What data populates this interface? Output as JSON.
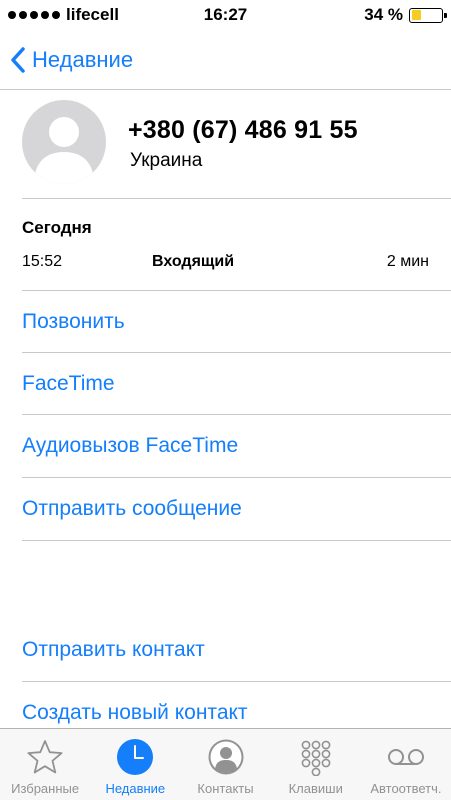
{
  "status_bar": {
    "carrier": "lifecell",
    "time": "16:27",
    "battery_percent": "34 %",
    "battery_level": 0.34
  },
  "nav": {
    "back_label": "Недавние"
  },
  "contact": {
    "phone_number": "+380 (67) 486 91 55",
    "country": "Украина"
  },
  "call_log": {
    "date": "Сегодня",
    "time": "15:52",
    "type": "Входящий",
    "duration": "2 мин"
  },
  "actions": {
    "call": "Позвонить",
    "facetime": "FaceTime",
    "facetime_audio": "Аудиовызов FaceTime",
    "send_message": "Отправить сообщение",
    "share_contact": "Отправить контакт",
    "create_contact": "Создать новый контакт"
  },
  "tabs": [
    {
      "label": "Избранные",
      "icon": "star-icon"
    },
    {
      "label": "Недавние",
      "icon": "clock-icon",
      "active": true
    },
    {
      "label": "Контакты",
      "icon": "contacts-icon"
    },
    {
      "label": "Клавиши",
      "icon": "keypad-icon"
    },
    {
      "label": "Автоответч.",
      "icon": "voicemail-icon"
    }
  ],
  "colors": {
    "accent": "#147efb",
    "battery": "#f5cc1f",
    "avatar_bg": "#d6d6d9",
    "tab_inactive": "#929292"
  }
}
